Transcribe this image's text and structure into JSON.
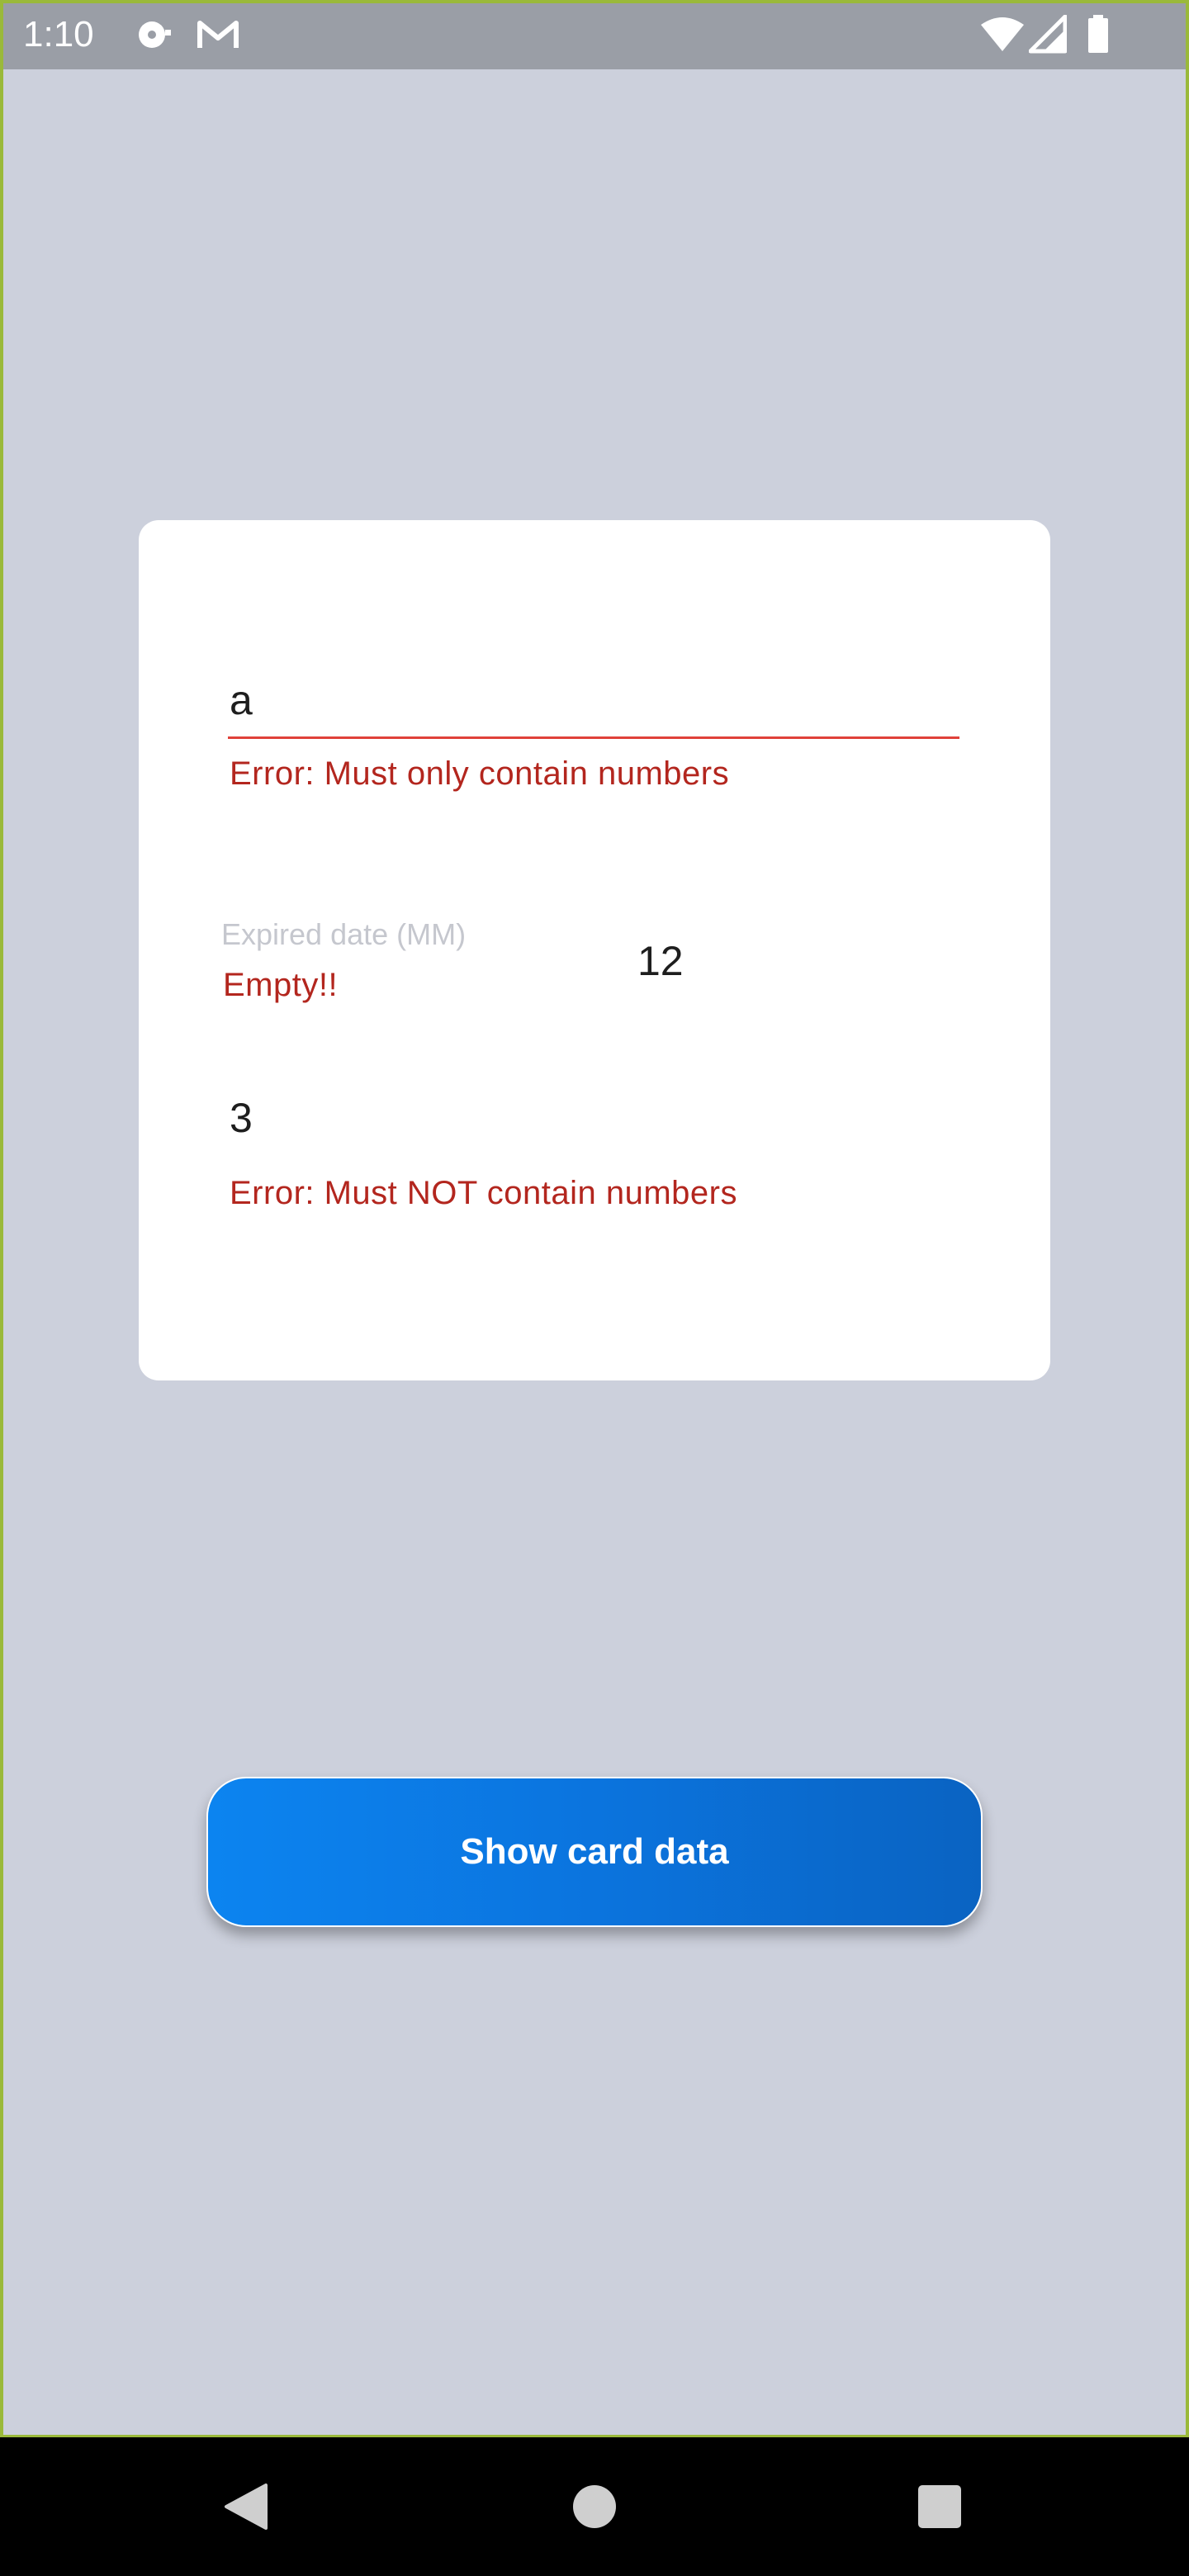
{
  "status_bar": {
    "time": "1:10",
    "icons": [
      "disc-notification-icon",
      "gmail-icon",
      "wifi-icon",
      "cell-signal-icon",
      "battery-icon"
    ]
  },
  "card": {
    "card_number": {
      "value": "a",
      "error": "Error: Must only contain numbers"
    },
    "expiry": {
      "label": "Expired date (MM)",
      "error": "Empty!!",
      "value": "12"
    },
    "name": {
      "value": "3",
      "error": "Error: Must NOT contain numbers"
    }
  },
  "actions": {
    "show_label": "Show card data"
  },
  "nav_bar": {
    "buttons": [
      "back-icon",
      "home-icon",
      "recents-icon"
    ]
  },
  "colors": {
    "background": "#ccd0dc",
    "error": "#b3261e",
    "underline_error": "#e0413a",
    "button_start": "#0c84f0",
    "button_end": "#0a63c2"
  }
}
